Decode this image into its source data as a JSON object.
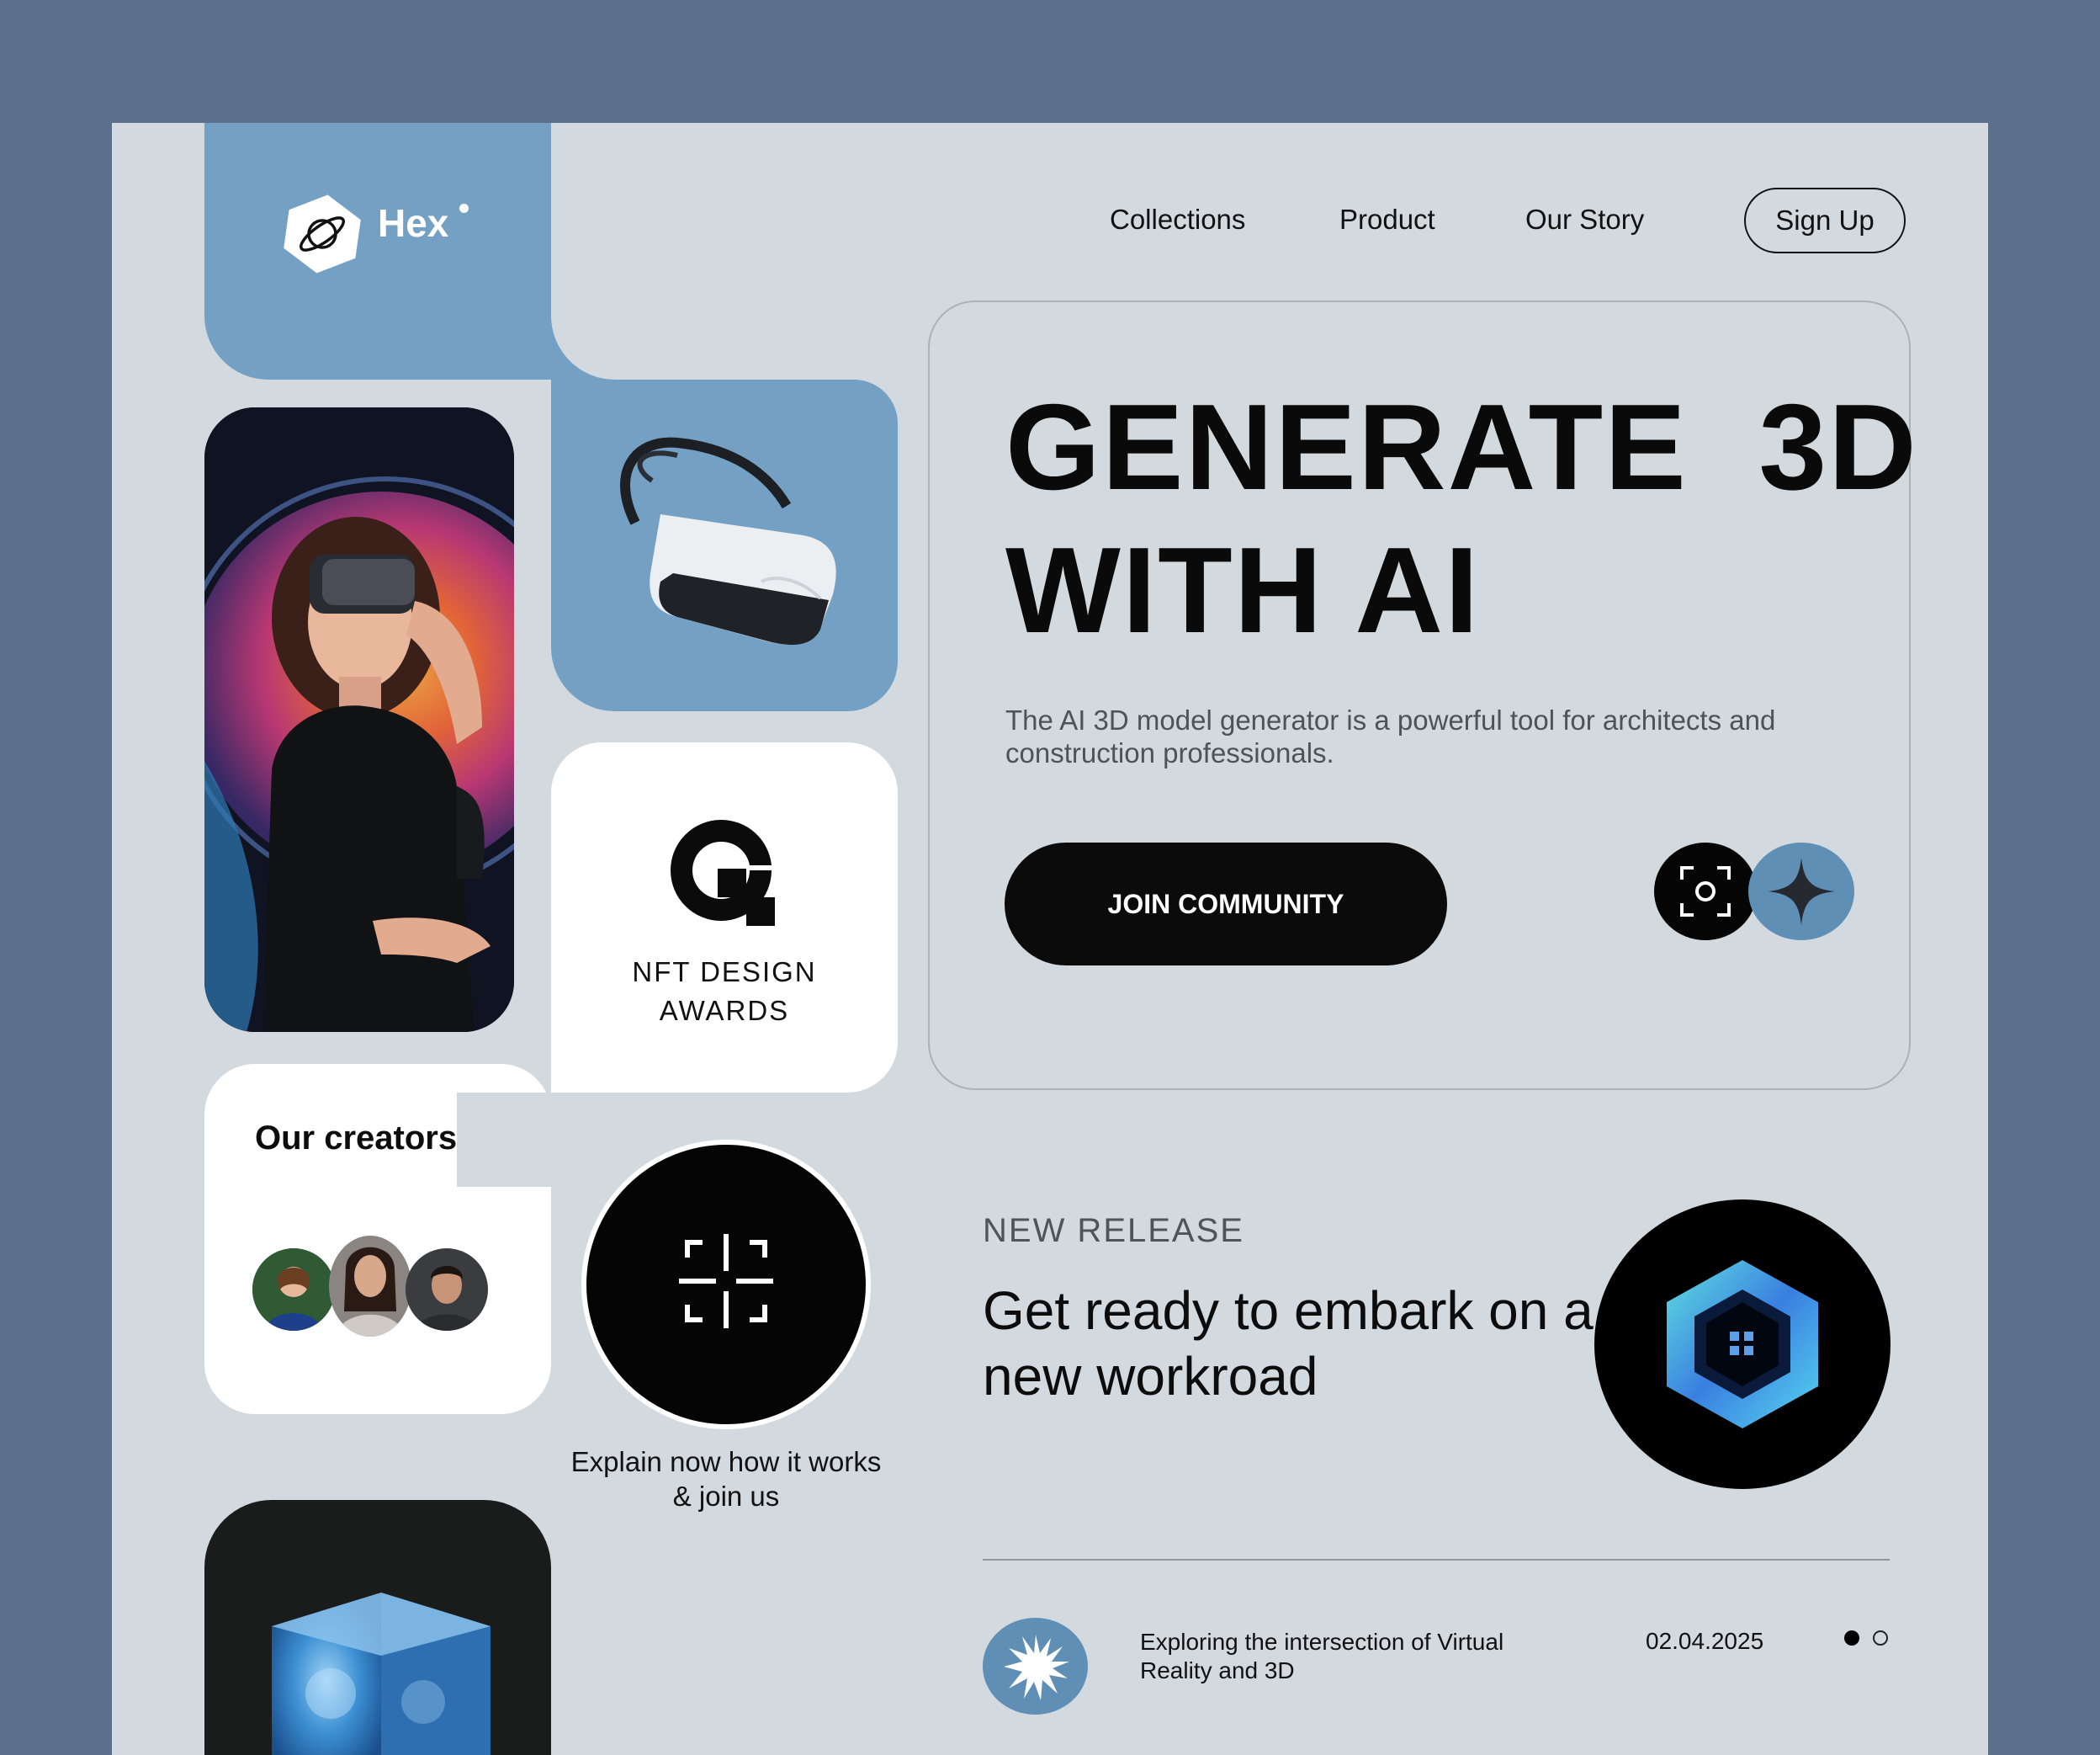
{
  "brand": {
    "name": "Hex",
    "logo_icon": "planet-icon"
  },
  "nav": {
    "links": [
      "Collections",
      "Product",
      "Our Story"
    ],
    "signup_label": "Sign Up"
  },
  "hero": {
    "title_line1": "GENERATE  3D",
    "title_line2": "WITH AI",
    "description": "The AI 3D model generator is a powerful tool for architects and construction professionals.",
    "cta_label": "JOIN COMMUNITY",
    "icons": [
      "scan-icon",
      "sparkle-icon"
    ]
  },
  "tiles": {
    "photo_alt": "woman-with-vr-headset",
    "vr_alt": "vr-headset",
    "nft_awards": {
      "line1": "NFT DESIGN",
      "line2": "AWARDS"
    },
    "creators": {
      "title": "Our creators",
      "avatar_count": 3
    },
    "explain": "Explain now how it works & join us",
    "cube_alt": "blue-crystal-cube"
  },
  "release": {
    "kicker": "NEW RELEASE",
    "title": "Get ready to embark on a new workroad",
    "badge_icon": "hexagon-home-icon"
  },
  "news": {
    "text": "Exploring the intersection of Virtual Reality and 3D",
    "date": "02.04.2025",
    "pager": {
      "count": 2,
      "active": 0
    }
  },
  "colors": {
    "outer_bg": "#5a6f8c",
    "frame_bg": "#d2d9df",
    "accent_blue": "#73a0c3",
    "dark": "#0b0b0b"
  }
}
